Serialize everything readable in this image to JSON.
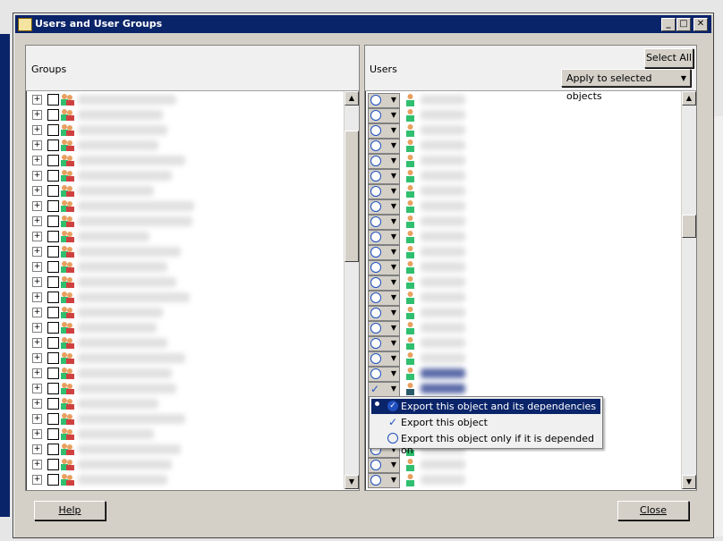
{
  "window": {
    "title": "Users and User Groups",
    "minimize_glyph": "_",
    "maximize_glyph": "□",
    "close_glyph": "✕"
  },
  "groups_panel": {
    "header": "Groups",
    "row_count": 26
  },
  "users_panel": {
    "header": "Users",
    "select_all_label": "Select All",
    "apply_label": "Apply to selected objects",
    "row_count": 26
  },
  "context_menu": {
    "items": [
      {
        "label": "Export this object and its dependencies",
        "icon": "checked-shield-icon",
        "selected": true
      },
      {
        "label": "Export this object",
        "icon": "checkmark-icon",
        "selected": false
      },
      {
        "label": "Export this object only if it is depended on",
        "icon": "no-entry-icon",
        "selected": false
      }
    ]
  },
  "footer": {
    "help_label": "Help",
    "close_label": "Close"
  },
  "colors": {
    "titlebar": "#0a246a",
    "selection": "#0a246a",
    "user_icon": "#2fbf6f"
  }
}
